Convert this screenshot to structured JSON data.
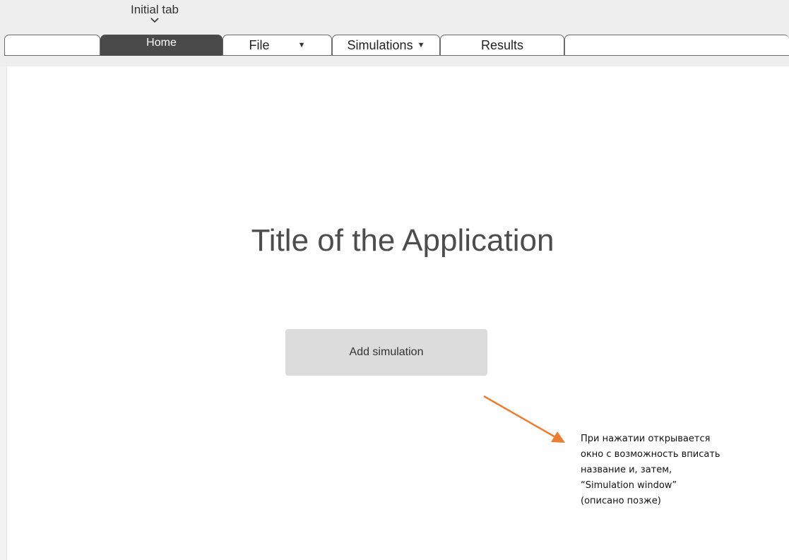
{
  "header": {
    "initial_tab_label": "Initial tab"
  },
  "tabs": [
    {
      "label": "",
      "active": false
    },
    {
      "label": "Home",
      "active": true
    },
    {
      "label": "File",
      "active": false,
      "dropdown": true
    },
    {
      "label": "Simulations",
      "active": false,
      "dropdown": true
    },
    {
      "label": "Results",
      "active": false
    },
    {
      "label": "",
      "active": false
    }
  ],
  "main": {
    "title": "Title of the Application",
    "add_simulation_label": "Add simulation"
  },
  "annotation": {
    "lines": [
      "При нажатии открывается",
      "окно с возможность вписать",
      "название и, затем,",
      "“Simulation window”",
      "(описано позже)"
    ],
    "arrow_color": "#ed7d31"
  },
  "colors": {
    "active_tab": "#4a4a4a",
    "button_bg": "#dcdcdc",
    "topbar_bg": "#eeeeee"
  }
}
